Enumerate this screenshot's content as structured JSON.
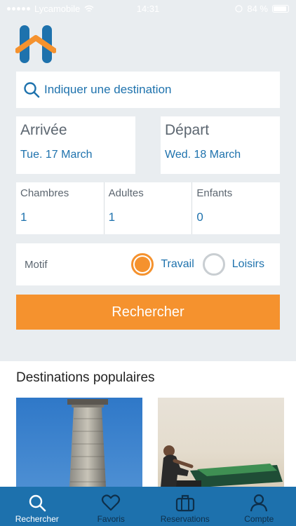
{
  "status": {
    "carrier": "Lycamobile",
    "time": "14:31",
    "battery": "84 %"
  },
  "search": {
    "placeholder": "Indiquer une destination"
  },
  "dates": {
    "arrival": {
      "label": "Arrivée",
      "value": "Tue. 17 March"
    },
    "departure": {
      "label": "Départ",
      "value": "Wed. 18 March"
    }
  },
  "counts": [
    {
      "label": "Chambres",
      "value": "1"
    },
    {
      "label": "Adultes",
      "value": "1"
    },
    {
      "label": "Enfants",
      "value": "0"
    }
  ],
  "motif": {
    "label": "Motif",
    "options": [
      {
        "label": "Travail",
        "selected": true
      },
      {
        "label": "Loisirs",
        "selected": false
      }
    ]
  },
  "search_button": "Rechercher",
  "popular": {
    "title": "Destinations populaires"
  },
  "tabs": [
    {
      "label": "Rechercher",
      "icon": "search-icon",
      "active": true
    },
    {
      "label": "Favoris",
      "icon": "heart-icon",
      "active": false
    },
    {
      "label": "Reservations",
      "icon": "briefcase-icon",
      "active": false
    },
    {
      "label": "Compte",
      "icon": "user-icon",
      "active": false
    }
  ],
  "colors": {
    "accent": "#f5922e",
    "primary": "#1e72ad",
    "tabbar": "#1d71ad"
  }
}
